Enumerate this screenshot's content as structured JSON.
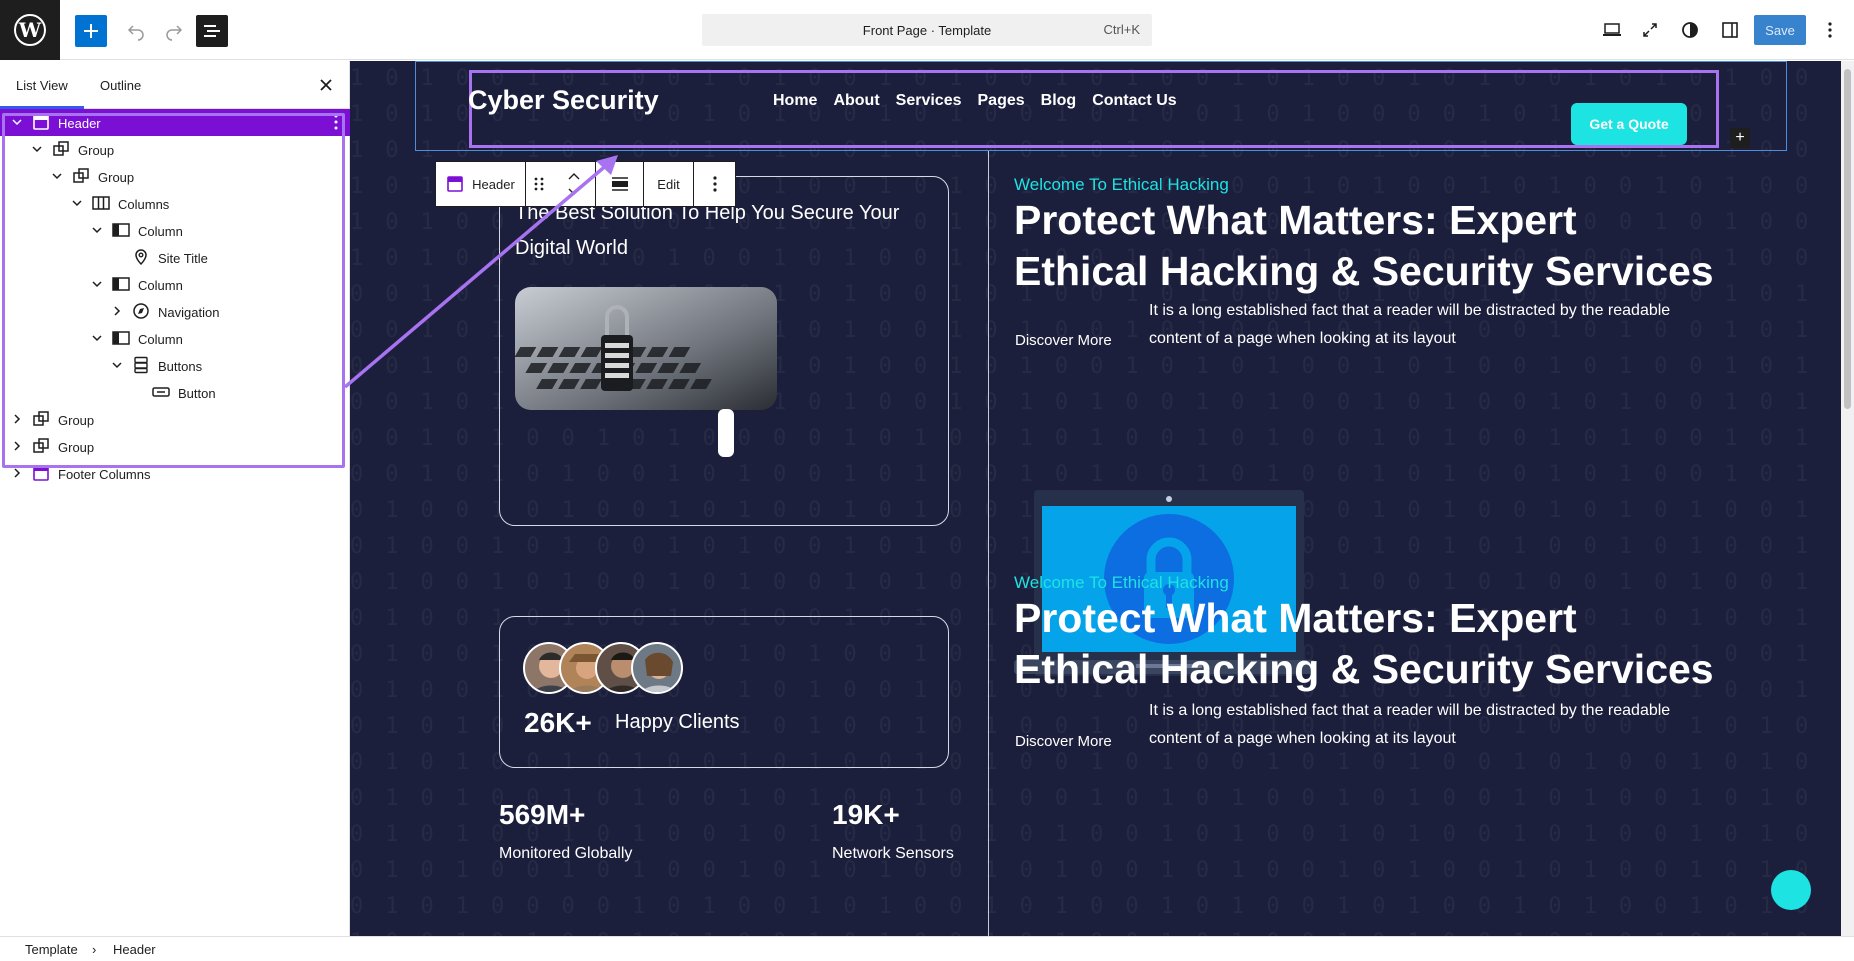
{
  "topbar": {
    "command_title": "Front Page · Template",
    "command_shortcut": "Ctrl+K",
    "save_label": "Save"
  },
  "sidebar": {
    "tabs": [
      "List View",
      "Outline"
    ],
    "tree": [
      {
        "label": "Header",
        "icon": "template-part-icon"
      },
      {
        "label": "Group",
        "icon": "group-icon"
      },
      {
        "label": "Group",
        "icon": "group-icon"
      },
      {
        "label": "Columns",
        "icon": "columns-icon"
      },
      {
        "label": "Column",
        "icon": "column-icon"
      },
      {
        "label": "Site Title",
        "icon": "map-marker-icon"
      },
      {
        "label": "Column",
        "icon": "column-icon"
      },
      {
        "label": "Navigation",
        "icon": "compass-icon"
      },
      {
        "label": "Column",
        "icon": "column-icon"
      },
      {
        "label": "Buttons",
        "icon": "buttons-icon"
      },
      {
        "label": "Button",
        "icon": "button-icon"
      },
      {
        "label": "Group",
        "icon": "group-icon"
      },
      {
        "label": "Group",
        "icon": "group-icon"
      },
      {
        "label": "Footer Columns",
        "icon": "template-part-icon"
      }
    ]
  },
  "block_toolbar": {
    "label": "Header",
    "edit_label": "Edit"
  },
  "site": {
    "title": "Cyber Security",
    "nav": [
      "Home",
      "About",
      "Services",
      "Pages",
      "Blog",
      "Contact Us"
    ],
    "cta": "Get a Quote",
    "card_text": "The Best Solution To Help You Secure Your Digital World",
    "hero1": {
      "welcome": "Welcome To Ethical Hacking",
      "title": "Protect What Matters: Expert Ethical Hacking & Security Services",
      "discover": "Discover More",
      "desc": "It is a long established fact that a reader will be distracted by the readable content of a page when looking at its layout"
    },
    "hero2": {
      "welcome": "Welcome To Ethical Hacking",
      "title": "Protect What Matters: Expert Ethical Hacking & Security Services",
      "discover": "Discover More",
      "desc": "It is a long established fact that a reader will be distracted by the readable content of a page when looking at its layout"
    },
    "clients_count": "26K+",
    "clients_label": "Happy Clients",
    "stats": [
      {
        "value": "569M+",
        "label": "Monitored Globally"
      },
      {
        "value": "19K+",
        "label": "Network Sensors"
      }
    ]
  },
  "breadcrumb": [
    "Template",
    "Header"
  ],
  "colors": {
    "wp_accent": "#3858e9",
    "selection_purple": "#7b10d4",
    "canvas_bg": "#1c1f3c",
    "cyan": "#1de3e3"
  }
}
